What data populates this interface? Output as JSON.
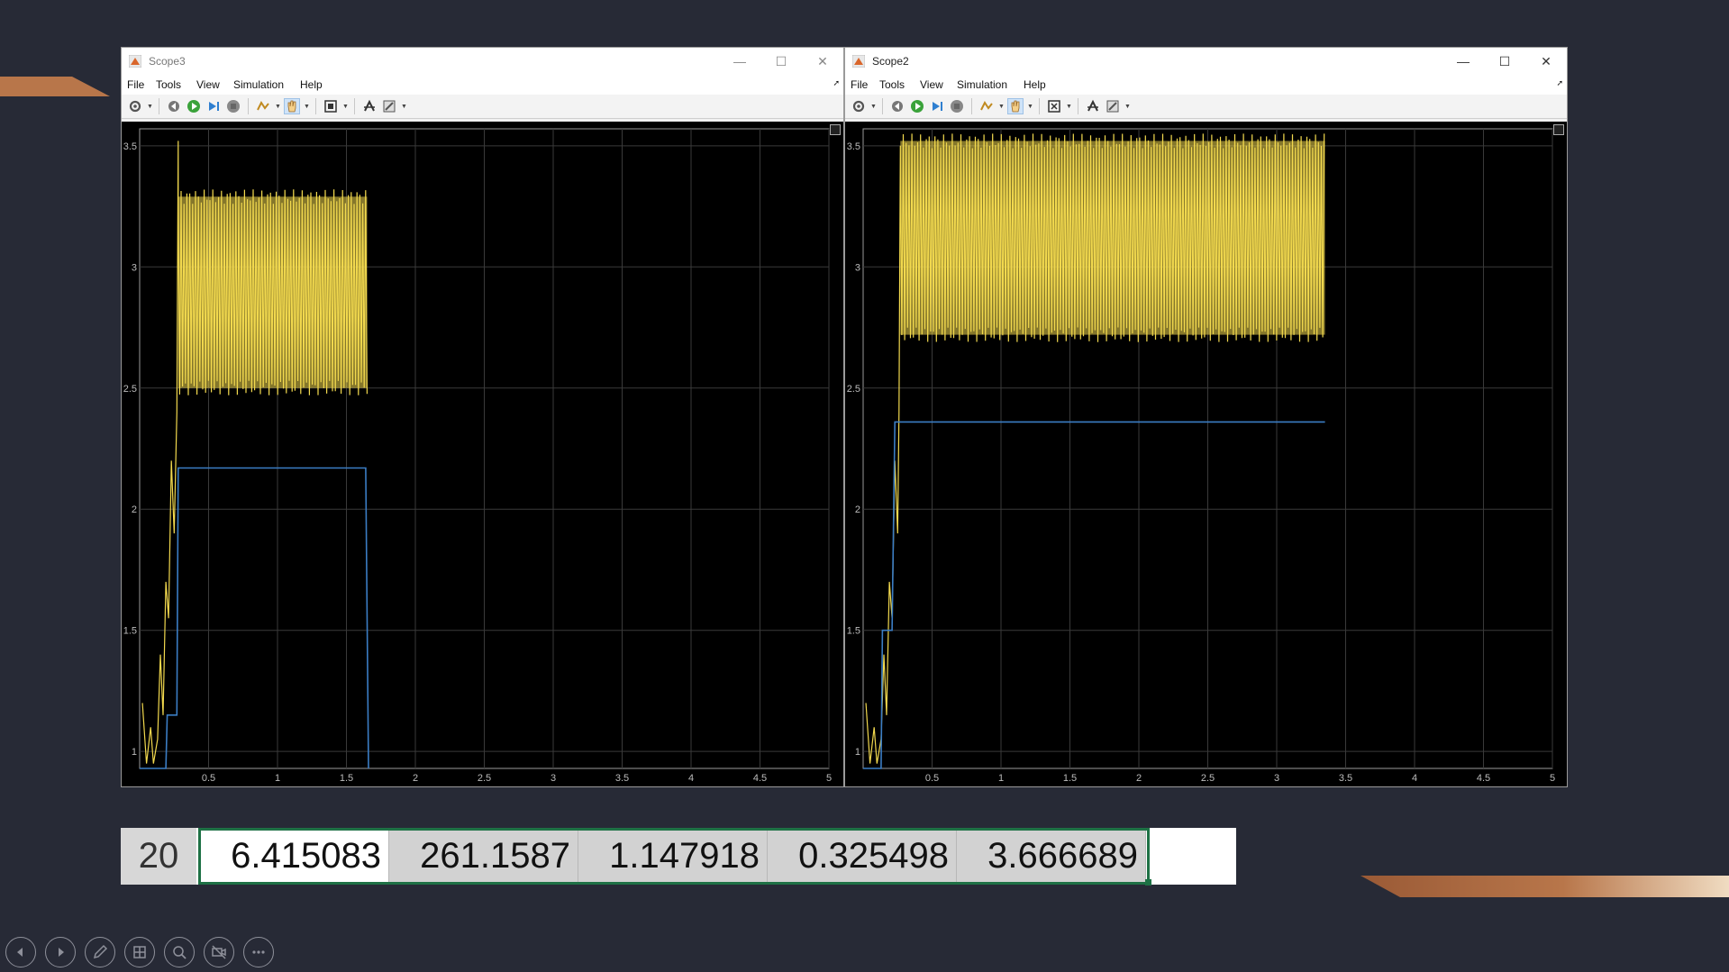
{
  "colors": {
    "background": "#272a36",
    "copper_accent": "#b8764a",
    "trace_yellow": "#f2d94e",
    "trace_blue": "#3b7dc4",
    "selection_green": "#1e7145"
  },
  "menu": [
    "File",
    "Tools",
    "View",
    "Simulation",
    "Help"
  ],
  "windows": [
    {
      "title": "Scope3",
      "controls": {
        "minimize": "—",
        "maximize": "☐",
        "close": "✕"
      },
      "chart_data": {
        "type": "line",
        "xlim": [
          0,
          5
        ],
        "ylim": [
          0.93,
          3.57
        ],
        "x_ticks": [
          "0.5",
          "1",
          "1.5",
          "2",
          "2.5",
          "3",
          "3.5",
          "4",
          "4.5",
          "5"
        ],
        "y_ticks": [
          "1",
          "1.5",
          "2",
          "2.5",
          "3",
          "3.5"
        ],
        "grid": true,
        "series": [
          {
            "color": "#f2d94e",
            "kind": "oscillating",
            "band_low": 2.5,
            "band_high": 3.29,
            "start": 0.28,
            "end": 1.65,
            "spike": 3.52
          },
          {
            "color": "#3b7dc4",
            "kind": "step",
            "x": [
              0.0,
              0.19,
              0.2,
              0.27,
              0.28,
              1.64,
              1.66
            ],
            "y": [
              0.93,
              0.93,
              1.15,
              1.15,
              2.17,
              2.17,
              0.93
            ]
          }
        ]
      }
    },
    {
      "title": "Scope2",
      "controls": {
        "minimize": "—",
        "maximize": "☐",
        "close": "✕"
      },
      "chart_data": {
        "type": "line",
        "xlim": [
          0,
          5
        ],
        "ylim": [
          0.93,
          3.57
        ],
        "x_ticks": [
          "0.5",
          "1",
          "1.5",
          "2",
          "2.5",
          "3",
          "3.5",
          "4",
          "4.5",
          "5"
        ],
        "y_ticks": [
          "1",
          "1.5",
          "2",
          "2.5",
          "3",
          "3.5"
        ],
        "grid": true,
        "series": [
          {
            "color": "#f2d94e",
            "kind": "oscillating",
            "band_low": 2.72,
            "band_high": 3.52,
            "start": 0.27,
            "end": 3.35,
            "spike": 3.5
          },
          {
            "color": "#3b7dc4",
            "kind": "step",
            "x": [
              0.0,
              0.13,
              0.14,
              0.21,
              0.23,
              3.35
            ],
            "y": [
              0.93,
              0.93,
              1.5,
              1.5,
              2.36,
              2.36
            ]
          }
        ]
      }
    }
  ],
  "table_row": {
    "row_number": "20",
    "values": [
      "6.415083",
      "261.1587",
      "1.147918",
      "0.325498",
      "3.666689"
    ]
  },
  "presenter_controls": [
    "previous-icon",
    "next-icon",
    "pen-icon",
    "slides-grid-icon",
    "zoom-icon",
    "camera-off-icon",
    "more-icon"
  ]
}
